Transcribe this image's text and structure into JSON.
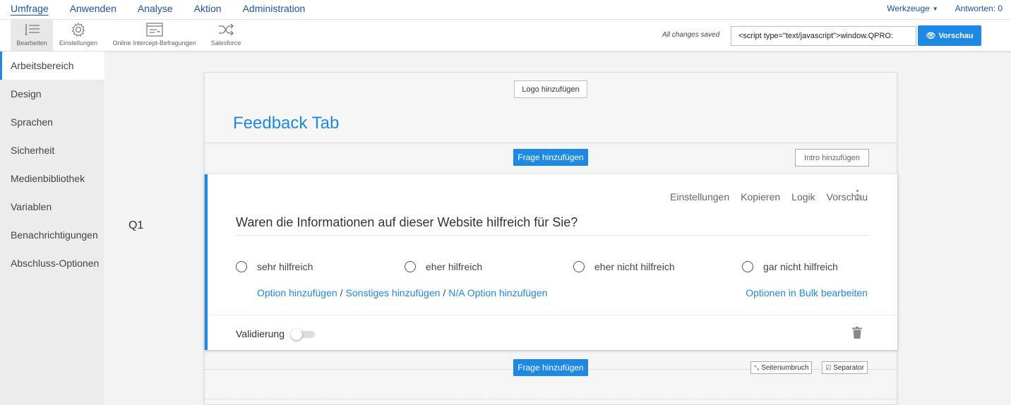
{
  "topnav": {
    "items": [
      {
        "label": "Umfrage"
      },
      {
        "label": "Anwenden"
      },
      {
        "label": "Analyse"
      },
      {
        "label": "Aktion"
      },
      {
        "label": "Administration"
      }
    ],
    "tools_label": "Werkzeuge",
    "responses_label": "Antworten: 0"
  },
  "toolbar": {
    "tools": [
      {
        "label": "Bearbeiten",
        "icon": "edit-list-icon"
      },
      {
        "label": "Einstellungen",
        "icon": "gear-icon"
      },
      {
        "label": "Online Intercept-Befragungen",
        "icon": "window-icon"
      },
      {
        "label": "Salesforce",
        "icon": "shuffle-icon"
      }
    ],
    "saved_status": "All changes saved",
    "code_value": "<script type=\"text/javascript\">window.QPRO:",
    "preview_label": "Vorschau"
  },
  "sidebar": {
    "items": [
      {
        "label": "Arbeitsbereich"
      },
      {
        "label": "Design"
      },
      {
        "label": "Sprachen"
      },
      {
        "label": "Sicherheit"
      },
      {
        "label": "Medienbibliothek"
      },
      {
        "label": "Variablen"
      },
      {
        "label": "Benachrichtigungen"
      },
      {
        "label": "Abschluss-Optionen"
      }
    ]
  },
  "question_number": "Q1",
  "canvas": {
    "logo_button": "Logo hinzufügen",
    "title": "Feedback Tab",
    "add_question": "Frage hinzufügen",
    "add_intro": "Intro hinzufügen",
    "page_break": "Seitenumbruch",
    "separator": "Separator"
  },
  "question": {
    "tools": [
      "Einstellungen",
      "Kopieren",
      "Logik",
      "Vorschau"
    ],
    "text": "Waren die Informationen auf dieser Website hilfreich für Sie?",
    "options": [
      "sehr hilfreich",
      "eher hilfreich",
      "eher nicht hilfreich",
      "gar nicht hilfreich"
    ],
    "add_option": "Option hinzufügen",
    "add_other": "Sonstiges hinzufügen",
    "add_na": "N/A Option hinzufügen",
    "link_separator": "/",
    "bulk_edit": "Optionen in Bulk bearbeiten",
    "validation": "Validierung"
  },
  "colors": {
    "accent": "#1e88e5",
    "nav_link": "#1a55a8"
  }
}
